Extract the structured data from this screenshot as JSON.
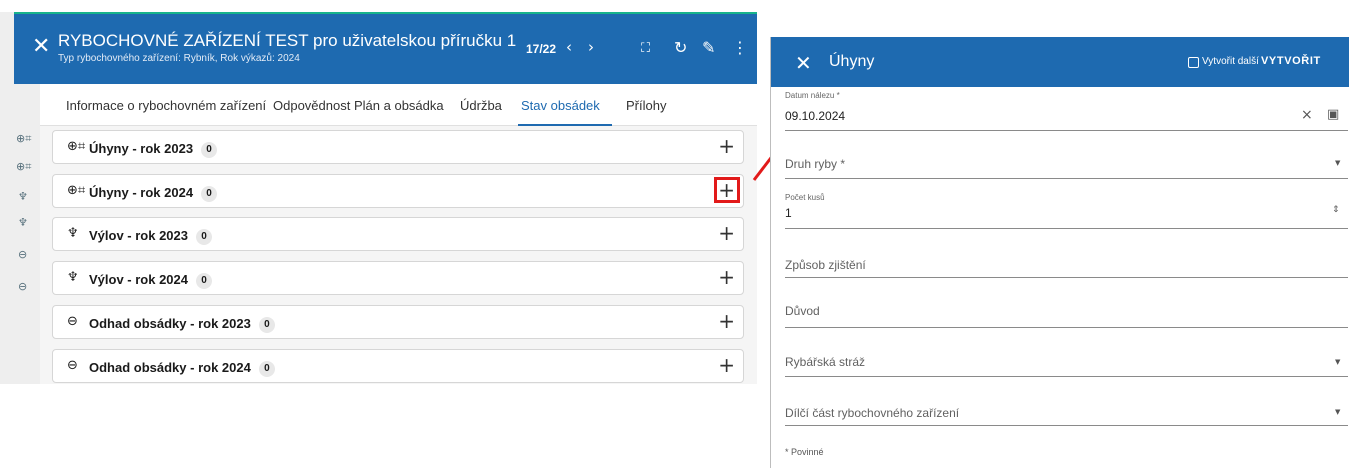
{
  "left_window": {
    "title": "RYBOCHOVNÉ ZAŘÍZENÍ TEST pro uživatelskou příručku 1",
    "subtitle": "Typ rybochovného zařízení: Rybník, Rok výkazů: 2024",
    "pager": "17/22",
    "prev_icon": "chevron-left-icon",
    "next_icon": "chevron-right-icon",
    "tabs": [
      {
        "label": "Informace o rybochovném zařízení"
      },
      {
        "label": "Odpovědnost"
      },
      {
        "label": "Plán a obsádka"
      },
      {
        "label": "Údržba"
      },
      {
        "label": "Stav obsádek",
        "active": true
      },
      {
        "label": "Přílohy"
      }
    ],
    "sections": [
      {
        "label": "Úhyny - rok 2023",
        "count": "0",
        "icon": "dead-fish-icon"
      },
      {
        "label": "Úhyny - rok 2024",
        "count": "0",
        "icon": "dead-fish-icon",
        "highlighted": true
      },
      {
        "label": "Výlov - rok 2023",
        "count": "0",
        "icon": "fish-catch-icon"
      },
      {
        "label": "Výlov - rok 2024",
        "count": "0",
        "icon": "fish-catch-icon"
      },
      {
        "label": "Odhad obsádky - rok 2023",
        "count": "0",
        "icon": "fish-estimate-icon"
      },
      {
        "label": "Odhad obsádky - rok 2024",
        "count": "0",
        "icon": "fish-estimate-icon"
      }
    ]
  },
  "dialog": {
    "title": "Úhyny",
    "create_another_label": "Vytvořit další",
    "create_another_checked": false,
    "create_label": "VYTVOŘIT",
    "fields": {
      "date_label": "Datum nálezu *",
      "date_value": "09.10.2024",
      "fish_type_placeholder": "Druh ryby *",
      "count_label": "Počet kusů",
      "count_value": "1",
      "detection_placeholder": "Způsob zjištění",
      "reason_placeholder": "Důvod",
      "guard_placeholder": "Rybářská stráž",
      "part_placeholder": "Dílčí část rybochovného zařízení"
    },
    "required_note": "* Povinné"
  },
  "colors": {
    "header_blue": "#1e6ab0",
    "highlight_red": "#e21a1a",
    "teal_accent": "#18b38b"
  }
}
